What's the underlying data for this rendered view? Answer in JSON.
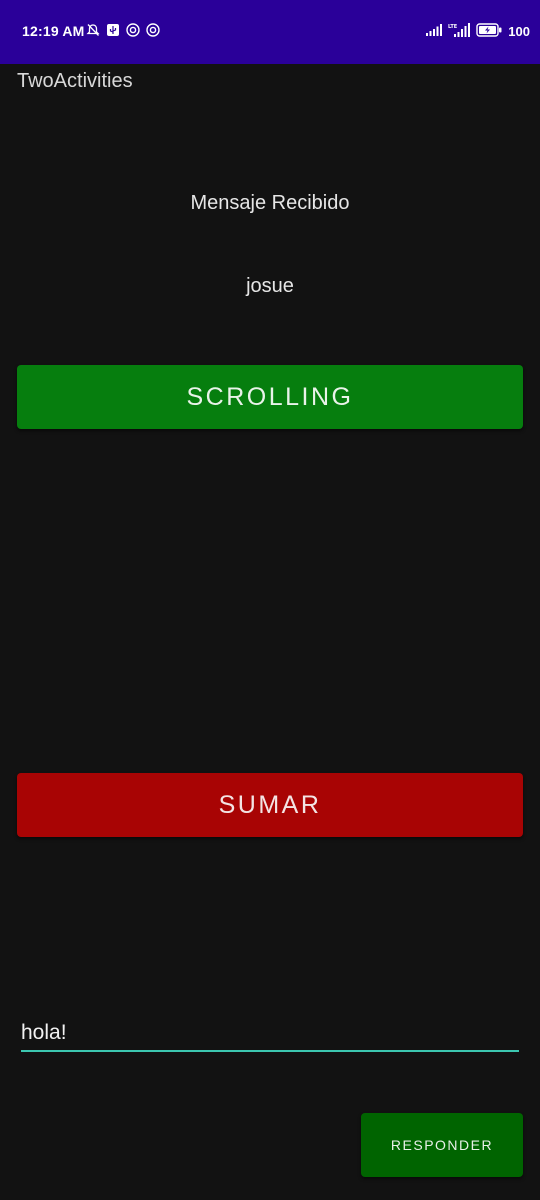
{
  "status_bar": {
    "time": "12:19 AM",
    "battery": "100",
    "icons": [
      "silent-icon",
      "usb-icon",
      "vpn-icon",
      "sync-icon",
      "signal-icon",
      "lte-signal-icon",
      "battery-charging-icon"
    ],
    "network": "LTE",
    "background_color": "#2a0099"
  },
  "app": {
    "title": "TwoActivities"
  },
  "main": {
    "message_label": "Mensaje Recibido",
    "message_text": "josue",
    "scrolling_button": "SCROLLING",
    "sumar_button": "SUMAR",
    "reply_input_value": "hola!",
    "responder_button": "RESPONDER"
  },
  "colors": {
    "scrolling_button": "#067e0e",
    "sumar_button": "#a80404",
    "responder_button": "#006400",
    "input_underline": "#3cc7b0",
    "background": "#121212"
  }
}
